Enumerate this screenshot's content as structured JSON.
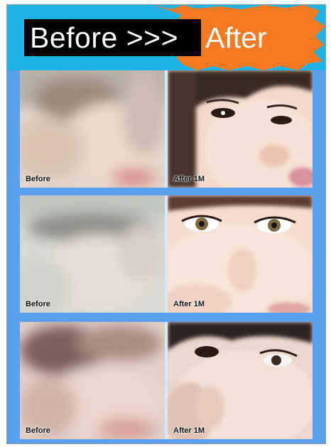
{
  "header": {
    "before_word": "Before >>>",
    "after_word": "After",
    "colors": {
      "banner": "#1fb2e6",
      "burst": "#f77a22",
      "frame": "#59a0ee"
    }
  },
  "rows": [
    {
      "before_label": "Before",
      "after_label": "After 1M"
    },
    {
      "before_label": "Before",
      "after_label": "After 1M"
    },
    {
      "before_label": "Before",
      "after_label": "After 1M"
    }
  ]
}
